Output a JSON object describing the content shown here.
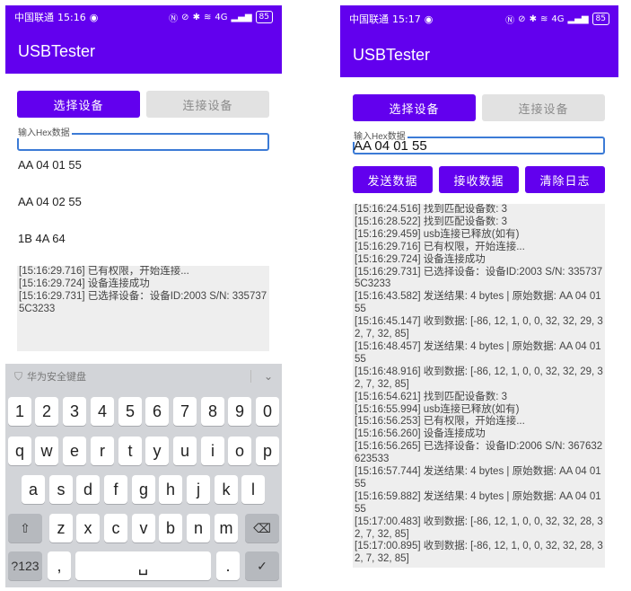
{
  "left": {
    "status": {
      "carrier": "中国联通",
      "time": "15:16",
      "network": "4G",
      "battery": "85"
    },
    "app_title": "USBTester",
    "select_device_label": "选择设备",
    "connect_device_label": "连接设备",
    "hex_input_label": "输入Hex数据",
    "dropdown_options": [
      "AA 04 01 55",
      "AA 04 02 55",
      "1B 4A 64"
    ],
    "log_lines": [
      "[15:16:29.716] 已有权限，开始连接...",
      "[15:16:29.724] 设备连接成功",
      "[15:16:29.731] 已选择设备：设备ID:2003 S/N: 3357375C3233"
    ],
    "keyboard": {
      "brand": "华为安全键盘",
      "row1": [
        "1",
        "2",
        "3",
        "4",
        "5",
        "6",
        "7",
        "8",
        "9",
        "0"
      ],
      "row2": [
        "q",
        "w",
        "e",
        "r",
        "t",
        "y",
        "u",
        "i",
        "o",
        "p"
      ],
      "row3": [
        "a",
        "s",
        "d",
        "f",
        "g",
        "h",
        "j",
        "k",
        "l"
      ],
      "row4": [
        "z",
        "x",
        "c",
        "v",
        "b",
        "n",
        "m"
      ],
      "symbols_label": "?123",
      "comma": ",",
      "period": "."
    }
  },
  "right": {
    "status": {
      "carrier": "中国联通",
      "time": "15:17",
      "network": "4G",
      "battery": "85"
    },
    "app_title": "USBTester",
    "select_device_label": "选择设备",
    "connect_device_label": "连接设备",
    "hex_input_label": "输入Hex数据",
    "hex_input_value": "AA 04 01 55",
    "send_label": "发送数据",
    "receive_label": "接收数据",
    "clear_log_label": "清除日志",
    "log_lines": [
      "[15:16:24.516] 找到匹配设备数: 3",
      "[15:16:28.522] 找到匹配设备数: 3",
      "[15:16:29.459] usb连接已释放(如有)",
      "[15:16:29.716] 已有权限，开始连接...",
      "[15:16:29.724] 设备连接成功",
      "[15:16:29.731] 已选择设备：设备ID:2003 S/N: 3357375C3233",
      "[15:16:43.582] 发送结果: 4 bytes | 原始数据: AA 04 01 55",
      "[15:16:45.147] 收到数据: [-86, 12, 1, 0, 0, 32, 32, 29, 32, 7, 32, 85]",
      "[15:16:48.457] 发送结果: 4 bytes | 原始数据: AA 04 01 55",
      "[15:16:48.916] 收到数据: [-86, 12, 1, 0, 0, 32, 32, 29, 32, 7, 32, 85]",
      "[15:16:54.621] 找到匹配设备数: 3",
      "[15:16:55.994] usb连接已释放(如有)",
      "[15:16:56.253] 已有权限，开始连接...",
      "[15:16:56.260] 设备连接成功",
      "[15:16:56.265] 已选择设备：设备ID:2006 S/N: 367632623533",
      "[15:16:57.744] 发送结果: 4 bytes | 原始数据: AA 04 01 55",
      "[15:16:59.882] 发送结果: 4 bytes | 原始数据: AA 04 01 55",
      "[15:17:00.483] 收到数据: [-86, 12, 1, 0, 0, 32, 32, 28, 32, 7, 32, 85]",
      "[15:17:00.895] 收到数据: [-86, 12, 1, 0, 0, 32, 32, 28, 32, 7, 32, 85]"
    ]
  },
  "colors": {
    "primary": "#6200ee",
    "disabled": "#e2e2e2",
    "log_bg": "#eeeeee",
    "input_focus": "#3c7bd6"
  }
}
